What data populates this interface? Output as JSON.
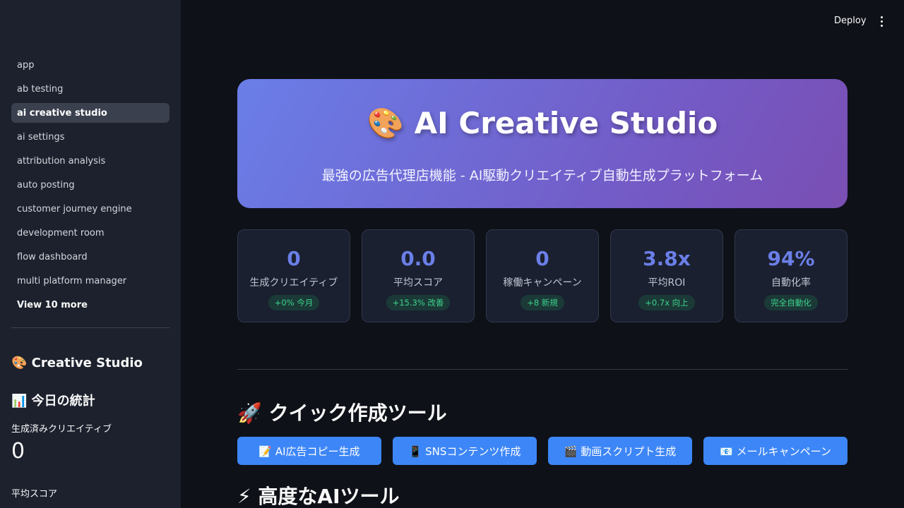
{
  "sidebar": {
    "nav_items": [
      {
        "label": "app"
      },
      {
        "label": "ab testing"
      },
      {
        "label": "ai creative studio",
        "active": true
      },
      {
        "label": "ai settings"
      },
      {
        "label": "attribution analysis"
      },
      {
        "label": "auto posting"
      },
      {
        "label": "customer journey engine"
      },
      {
        "label": "development room"
      },
      {
        "label": "flow dashboard"
      },
      {
        "label": "multi platform manager"
      }
    ],
    "view_more": "View 10 more",
    "title": "🎨 Creative Studio",
    "stats_title": "📊 今日の統計",
    "metrics": [
      {
        "label": "生成済みクリエイティブ",
        "value": "0"
      },
      {
        "label": "平均スコア",
        "value": ""
      }
    ]
  },
  "header": {
    "deploy_label": "Deploy"
  },
  "hero": {
    "title": "🎨 AI Creative Studio",
    "subtitle": "最強の広告代理店機能 - AI駆動クリエイティブ自動生成プラットフォーム"
  },
  "cards": [
    {
      "value": "0",
      "label": "生成クリエイティブ",
      "badge": "+0% 今月"
    },
    {
      "value": "0.0",
      "label": "平均スコア",
      "badge": "+15.3% 改善"
    },
    {
      "value": "0",
      "label": "稼働キャンペーン",
      "badge": "+8 新規"
    },
    {
      "value": "3.8x",
      "label": "平均ROI",
      "badge": "+0.7x 向上"
    },
    {
      "value": "94%",
      "label": "自動化率",
      "badge": "完全自動化"
    }
  ],
  "quick_tools": {
    "title": "🚀 クイック作成ツール",
    "buttons": [
      {
        "label": "📝 AI広告コピー生成"
      },
      {
        "label": "📱 SNSコンテンツ作成"
      },
      {
        "label": "🎬 動画スクリプト生成"
      },
      {
        "label": "📧 メールキャンペーン"
      }
    ]
  },
  "advanced_tools": {
    "title": "⚡ 高度なAIツール"
  },
  "colors": {
    "accent": "#3d86f7",
    "metric_value": "#6b7fe8",
    "badge_text": "#3ed28c",
    "sidebar_bg": "#1c212d",
    "page_bg": "#0e1117"
  }
}
